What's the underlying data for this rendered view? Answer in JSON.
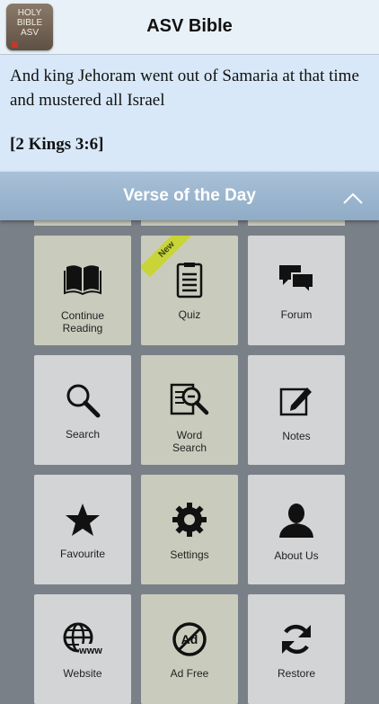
{
  "header": {
    "title": "ASV Bible",
    "app_icon_lines": [
      "HOLY",
      "BIBLE",
      "ASV"
    ]
  },
  "verse": {
    "text": "And king Jehoram went out of Samaria at that time and mustered all Israel",
    "reference": "[2 Kings 3:6]"
  },
  "votd_bar": {
    "label": "Verse of the Day"
  },
  "tiles": {
    "continue": {
      "label1": "Continue",
      "label2": "Reading"
    },
    "quiz": {
      "label": "Quiz",
      "badge": "New"
    },
    "forum": {
      "label": "Forum"
    },
    "search": {
      "label": "Search"
    },
    "word_search": {
      "label1": "Word",
      "label2": "Search"
    },
    "notes": {
      "label": "Notes"
    },
    "favourite": {
      "label": "Favourite"
    },
    "settings": {
      "label": "Settings"
    },
    "about": {
      "label": "About Us"
    },
    "website": {
      "label": "Website",
      "icon_text": "www"
    },
    "ad_free": {
      "label": "Ad Free",
      "icon_text": "Ad"
    },
    "restore": {
      "label": "Restore"
    }
  },
  "colors": {
    "tile_green": "#c9ccbd",
    "tile_gray": "#d3d4d5",
    "accent_bar": "#9db6cf",
    "badge": "#c8d438"
  }
}
